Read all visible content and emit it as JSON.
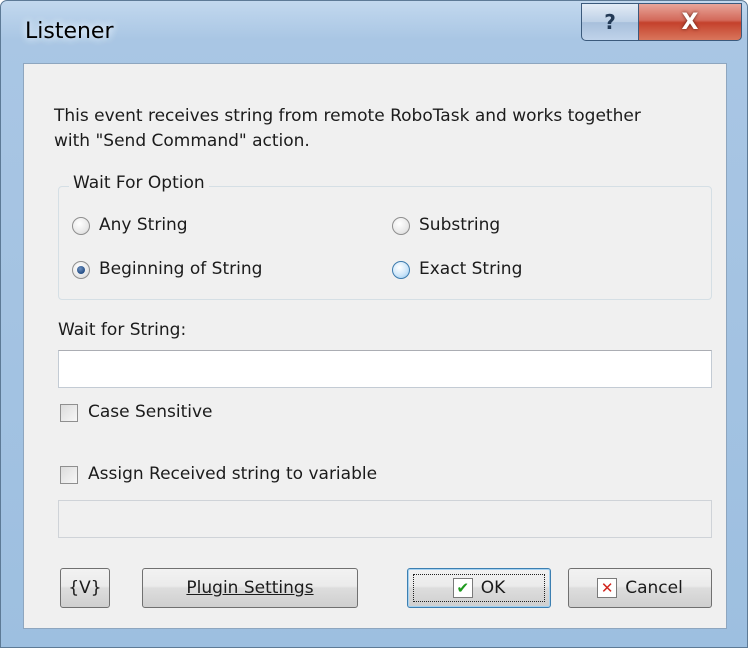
{
  "window": {
    "title": "Listener",
    "help_glyph": "?",
    "close_glyph": "X"
  },
  "description": "This event receives string from remote RoboTask and works together with \"Send Command\" action.",
  "wait_for_option": {
    "legend": "Wait For Option",
    "options": [
      {
        "label": "Any String",
        "checked": false
      },
      {
        "label": "Substring",
        "checked": false
      },
      {
        "label": "Beginning of String",
        "checked": true
      },
      {
        "label": "Exact String",
        "checked": false
      }
    ],
    "selected": "Beginning of String"
  },
  "wait_for_string": {
    "label": "Wait for String:",
    "value": ""
  },
  "case_sensitive": {
    "label": "Case Sensitive",
    "checked": false
  },
  "assign_variable": {
    "label": "Assign Received string to variable",
    "checked": false,
    "value": ""
  },
  "buttons": {
    "variables": "{V}",
    "plugin_settings": "Plugin Settings",
    "ok": "OK",
    "cancel": "Cancel"
  },
  "colors": {
    "title_bar": "#a9c6e4",
    "client_bg": "#f0f0f0",
    "close_button": "#c4412c",
    "ok_check": "#1e9a1e",
    "cancel_x": "#d2261e"
  }
}
